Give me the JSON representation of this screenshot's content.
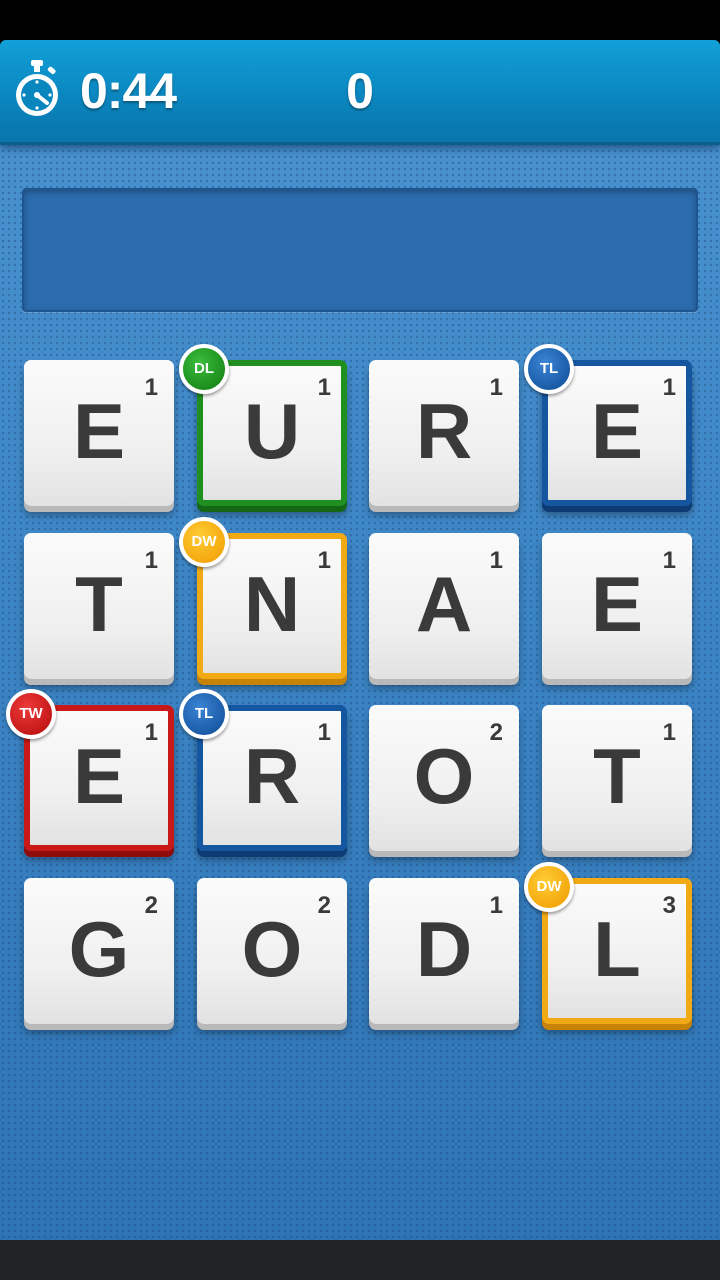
{
  "header": {
    "timer": "0:44",
    "score": "0",
    "icon": "stopwatch-icon"
  },
  "current_word": "",
  "colors": {
    "board_blue": "#3f86c4",
    "header_blue": "#0b86bf",
    "DL": "#1f8f1f",
    "TL": "#1556a0",
    "DW": "#f2aa14",
    "TW": "#c81818"
  },
  "board": [
    {
      "letter": "E",
      "points": "1",
      "bonus": ""
    },
    {
      "letter": "U",
      "points": "1",
      "bonus": "DL"
    },
    {
      "letter": "R",
      "points": "1",
      "bonus": ""
    },
    {
      "letter": "E",
      "points": "1",
      "bonus": "TL"
    },
    {
      "letter": "T",
      "points": "1",
      "bonus": ""
    },
    {
      "letter": "N",
      "points": "1",
      "bonus": "DW"
    },
    {
      "letter": "A",
      "points": "1",
      "bonus": ""
    },
    {
      "letter": "E",
      "points": "1",
      "bonus": ""
    },
    {
      "letter": "E",
      "points": "1",
      "bonus": "TW"
    },
    {
      "letter": "R",
      "points": "1",
      "bonus": "TL"
    },
    {
      "letter": "O",
      "points": "2",
      "bonus": ""
    },
    {
      "letter": "T",
      "points": "1",
      "bonus": ""
    },
    {
      "letter": "G",
      "points": "2",
      "bonus": ""
    },
    {
      "letter": "O",
      "points": "2",
      "bonus": ""
    },
    {
      "letter": "D",
      "points": "1",
      "bonus": ""
    },
    {
      "letter": "L",
      "points": "3",
      "bonus": "DW"
    }
  ]
}
